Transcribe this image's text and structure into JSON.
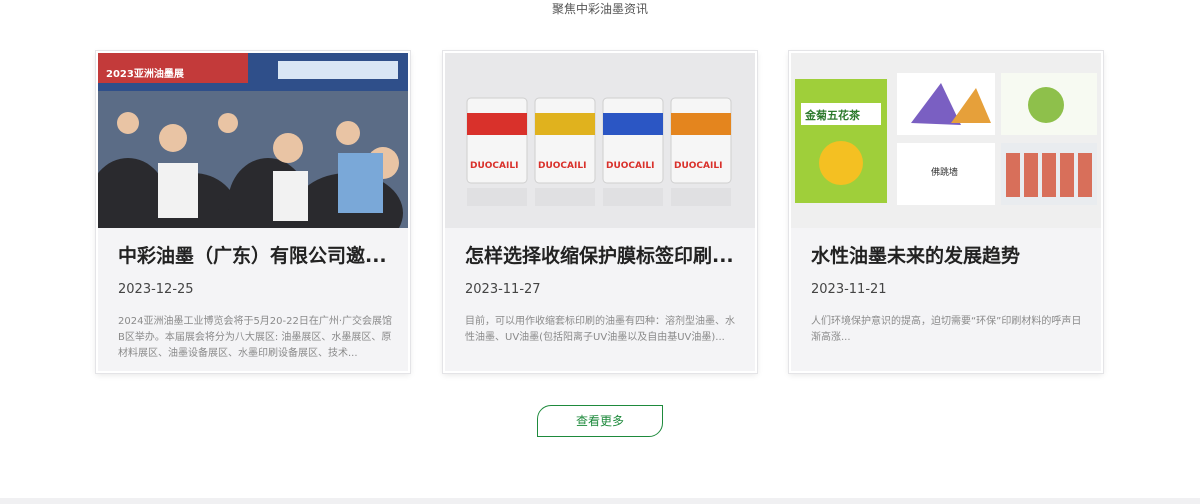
{
  "section": {
    "subtitle": "聚焦中彩油墨资讯"
  },
  "cards": [
    {
      "title": "中彩油墨（广东）有限公司邀...",
      "date": "2023-12-25",
      "desc": "2024亚洲油墨工业博览会将于5月20-22日在广州·广交会展馆B区举办。本届展会将分为八大展区: 油墨展区、水墨展区、原材料展区、油墨设备展区、水墨印刷设备展区、技术...",
      "banner_text": "2023亚洲油墨展"
    },
    {
      "title": "怎样选择收缩保护膜标签印刷...",
      "date": "2023-11-27",
      "desc": "目前，可以用作收缩套标印刷的油墨有四种：溶剂型油墨、水性油墨、UV油墨(包括阳离子UV油墨以及自由基UV油墨)...",
      "bucket_label": "DUOCAILI"
    },
    {
      "title": "水性油墨未来的发展趋势",
      "date": "2023-11-21",
      "desc": "人们环境保护意识的提高，迫切需要“环保”印刷材料的呼声日渐高涨...",
      "package_label": "金菊五花茶",
      "package_label_2": "佛跳墙"
    }
  ],
  "more_button": {
    "label": "查看更多"
  }
}
